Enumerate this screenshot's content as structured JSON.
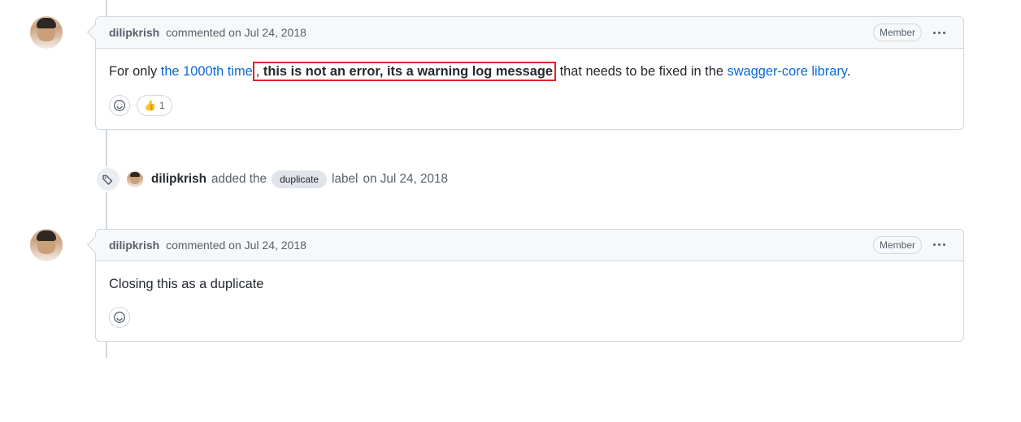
{
  "comment1": {
    "author": "dilipkrish",
    "action": "commented",
    "date": "on Jul 24, 2018",
    "role": "Member",
    "body": {
      "prefix": "For only ",
      "link1": "the 1000th time",
      "mid_leadin": ", ",
      "highlighted": "this is not an error, its a warning log message",
      "mid_out": " that needs to be fixed in the ",
      "link2": "swagger-core library",
      "suffix": "."
    },
    "reaction_count": "1"
  },
  "event": {
    "author": "dilipkrish",
    "pre": "added the",
    "label": "duplicate",
    "post": "label",
    "date": "on Jul 24, 2018"
  },
  "comment2": {
    "author": "dilipkrish",
    "action": "commented",
    "date": "on Jul 24, 2018",
    "role": "Member",
    "body": "Closing this as a duplicate"
  }
}
